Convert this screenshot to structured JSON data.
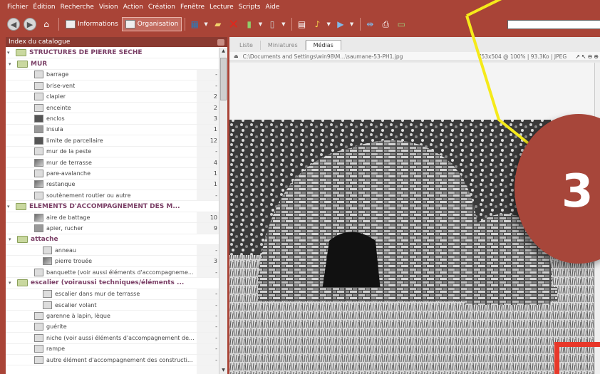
{
  "menu": [
    "Fichier",
    "Édition",
    "Recherche",
    "Vision",
    "Action",
    "Création",
    "Fenêtre",
    "Lecture",
    "Scripts",
    "Aide"
  ],
  "toolbar": {
    "info_label": "Informations",
    "org_label": "Organisation",
    "icons": [
      "back-icon",
      "forward-icon",
      "home-icon",
      "export-icon",
      "folder-open-icon",
      "delete-icon",
      "tag-icon",
      "attach-icon",
      "edit-icon",
      "import-icon",
      "movie-icon",
      "join-icon",
      "print-icon",
      "slideshow-icon"
    ]
  },
  "catalog": {
    "title": "Index du catalogue",
    "rows": [
      {
        "level": 0,
        "type": "group",
        "label": "STRUCTURES DE PIERRE SECHE",
        "count": "",
        "expand": "▾"
      },
      {
        "level": 1,
        "type": "group",
        "label": "MUR",
        "count": "",
        "expand": "▾"
      },
      {
        "level": 2,
        "type": "item",
        "label": "barrage",
        "count": "-",
        "thumb": "blank"
      },
      {
        "level": 2,
        "type": "item",
        "label": "brise-vent",
        "count": "-",
        "thumb": "blank"
      },
      {
        "level": 2,
        "type": "item",
        "label": "clapier",
        "count": "2",
        "thumb": "blank"
      },
      {
        "level": 2,
        "type": "item",
        "label": "enceinte",
        "count": "2",
        "thumb": "blank"
      },
      {
        "level": 2,
        "type": "item",
        "label": "enclos",
        "count": "3",
        "thumb": "dark"
      },
      {
        "level": 2,
        "type": "item",
        "label": "insula",
        "count": "1",
        "thumb": "mid"
      },
      {
        "level": 2,
        "type": "item",
        "label": "limite de parcellaire",
        "count": "12",
        "thumb": "dark"
      },
      {
        "level": 2,
        "type": "item",
        "label": "mur de la peste",
        "count": "-",
        "thumb": "blank"
      },
      {
        "level": 2,
        "type": "item",
        "label": "mur de terrasse",
        "count": "4",
        "thumb": "photo"
      },
      {
        "level": 2,
        "type": "item",
        "label": "pare-avalanche",
        "count": "1",
        "thumb": "blank"
      },
      {
        "level": 2,
        "type": "item",
        "label": "restanque",
        "count": "1",
        "thumb": "photo"
      },
      {
        "level": 2,
        "type": "item",
        "label": "soutènement routier ou autre",
        "count": "-",
        "thumb": "blank"
      },
      {
        "level": 0,
        "type": "group",
        "label": "ELEMENTS D'ACCOMPAGNEMENT DES M...",
        "count": "",
        "expand": "▾"
      },
      {
        "level": 2,
        "type": "item",
        "label": "aire de battage",
        "count": "10",
        "thumb": "photo"
      },
      {
        "level": 2,
        "type": "item",
        "label": "apier, rucher",
        "count": "9",
        "thumb": "mid"
      },
      {
        "level": 1,
        "type": "group",
        "label": "attache",
        "count": "",
        "expand": "▾"
      },
      {
        "level": 3,
        "type": "item",
        "label": "anneau",
        "count": "-",
        "thumb": "blank"
      },
      {
        "level": 3,
        "type": "item",
        "label": "pierre trouée",
        "count": "3",
        "thumb": "photo"
      },
      {
        "level": 2,
        "type": "item",
        "label": "banquette (voir aussi éléments d'accompagneme...",
        "count": "-",
        "thumb": "blank"
      },
      {
        "level": 1,
        "type": "group",
        "label": "escalier (voiraussi techniques/éléments ...",
        "count": "",
        "expand": "▾"
      },
      {
        "level": 3,
        "type": "item",
        "label": "escalier dans mur de terrasse",
        "count": "-",
        "thumb": "blank"
      },
      {
        "level": 3,
        "type": "item",
        "label": "escalier volant",
        "count": "-",
        "thumb": "blank"
      },
      {
        "level": 2,
        "type": "item",
        "label": "garenne à lapin, lèque",
        "count": "-",
        "thumb": "blank"
      },
      {
        "level": 2,
        "type": "item",
        "label": "guérite",
        "count": "-",
        "thumb": "blank"
      },
      {
        "level": 2,
        "type": "item",
        "label": "niche (voir aussi éléments d'accompagnement de...",
        "count": "-",
        "thumb": "blank"
      },
      {
        "level": 2,
        "type": "item",
        "label": "rampe",
        "count": "-",
        "thumb": "blank"
      },
      {
        "level": 2,
        "type": "item",
        "label": "autre élément d'accompagnement des constructi...",
        "count": "-",
        "thumb": "blank"
      }
    ]
  },
  "viewer": {
    "tabs": [
      "Liste",
      "Miniatures",
      "Médias"
    ],
    "active_tab": "Médias",
    "path": "C:\\Documents and Settings\\win98\\M...\\saumane-53-PH1.jpg",
    "info": "753x504 @ 100% | 93.3Ko | JPEG"
  },
  "overlay": {
    "step": "3"
  }
}
